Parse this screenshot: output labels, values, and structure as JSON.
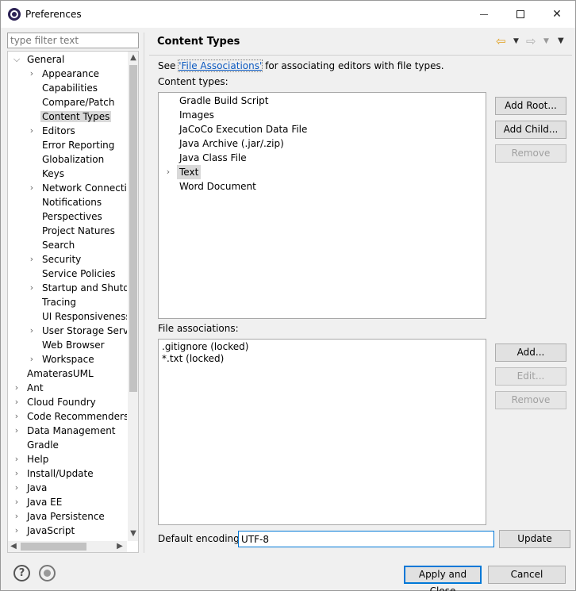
{
  "window": {
    "title": "Preferences"
  },
  "filter": {
    "placeholder": "type filter text",
    "value": ""
  },
  "tree": {
    "items": [
      {
        "label": "General",
        "expanded": true,
        "selected": false
      },
      {
        "label": "Appearance",
        "expandable": true
      },
      {
        "label": "Capabilities"
      },
      {
        "label": "Compare/Patch"
      },
      {
        "label": "Content Types",
        "selected": true
      },
      {
        "label": "Editors",
        "expandable": true
      },
      {
        "label": "Error Reporting"
      },
      {
        "label": "Globalization"
      },
      {
        "label": "Keys"
      },
      {
        "label": "Network Connection",
        "expandable": true
      },
      {
        "label": "Notifications"
      },
      {
        "label": "Perspectives"
      },
      {
        "label": "Project Natures"
      },
      {
        "label": "Search"
      },
      {
        "label": "Security",
        "expandable": true
      },
      {
        "label": "Service Policies"
      },
      {
        "label": "Startup and Shutdo",
        "expandable": true
      },
      {
        "label": "Tracing"
      },
      {
        "label": "UI Responsiveness M"
      },
      {
        "label": "User Storage Service",
        "expandable": true
      },
      {
        "label": "Web Browser"
      },
      {
        "label": "Workspace",
        "expandable": true
      },
      {
        "label": "AmaterasUML"
      },
      {
        "label": "Ant",
        "expandable": true
      },
      {
        "label": "Cloud Foundry",
        "expandable": true
      },
      {
        "label": "Code Recommenders",
        "expandable": true
      },
      {
        "label": "Data Management",
        "expandable": true
      },
      {
        "label": "Gradle"
      },
      {
        "label": "Help",
        "expandable": true
      },
      {
        "label": "Install/Update",
        "expandable": true
      },
      {
        "label": "Java",
        "expandable": true
      },
      {
        "label": "Java EE",
        "expandable": true
      },
      {
        "label": "Java Persistence",
        "expandable": true
      },
      {
        "label": "JavaScript",
        "expandable": true
      }
    ]
  },
  "page": {
    "title": "Content Types",
    "see_prefix": "See ",
    "see_link": "'File Associations'",
    "see_suffix": " for associating editors with file types.",
    "content_types_label": "Content types:",
    "content_types": [
      {
        "label": "Gradle Build Script"
      },
      {
        "label": "Images"
      },
      {
        "label": "JaCoCo Execution Data File"
      },
      {
        "label": "Java Archive (.jar/.zip)"
      },
      {
        "label": "Java Class File"
      },
      {
        "label": "Text",
        "selected": true,
        "expandable": true
      },
      {
        "label": "Word Document"
      }
    ],
    "file_assoc_label": "File associations:",
    "file_associations": [
      {
        "label": ".gitignore (locked)"
      },
      {
        "label": "*.txt (locked)"
      }
    ],
    "buttons": {
      "add_root": "Add Root...",
      "add_child": "Add Child...",
      "remove_ct": "Remove",
      "add_fa": "Add...",
      "edit_fa": "Edit...",
      "remove_fa": "Remove",
      "update": "Update"
    },
    "encoding_label": "Default encoding:",
    "encoding_value": "UTF-8"
  },
  "footer": {
    "apply_close": "Apply and Close",
    "cancel": "Cancel"
  },
  "colors": {
    "accent": "#0078d7",
    "link": "#0a58c0",
    "nav_back": "#e0a020"
  },
  "icons": {
    "nav_back": "arrow-left-icon",
    "nav_forward": "arrow-right-icon",
    "help": "help-icon",
    "import_export": "import-export-icon"
  }
}
